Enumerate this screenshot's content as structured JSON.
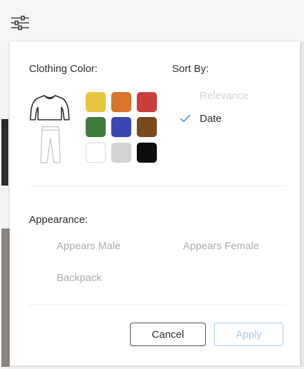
{
  "toolbar": {
    "filter_icon": "sliders-icon"
  },
  "panel": {
    "clothing_color_label": "Clothing Color:",
    "sort_by_label": "Sort By:",
    "appearance_label": "Appearance:",
    "garments": [
      "shirt-icon",
      "pants-icon"
    ],
    "swatches": [
      {
        "name": "yellow",
        "color": "#e8c53f"
      },
      {
        "name": "orange",
        "color": "#d9742b"
      },
      {
        "name": "red",
        "color": "#c83e3a"
      },
      {
        "name": "green",
        "color": "#3f7d3c"
      },
      {
        "name": "blue",
        "color": "#3948b0"
      },
      {
        "name": "brown",
        "color": "#7a4a1e"
      },
      {
        "name": "white",
        "color": "#ffffff"
      },
      {
        "name": "gray",
        "color": "#d3d3d3"
      },
      {
        "name": "black",
        "color": "#0d0d0d"
      }
    ],
    "sort_options": [
      {
        "label": "Relevance",
        "selected": false
      },
      {
        "label": "Date",
        "selected": true
      }
    ],
    "appearance_options": [
      "Appears Male",
      "Appears Female",
      "Backpack"
    ],
    "cancel_label": "Cancel",
    "apply_label": "Apply",
    "accent_color": "#5b9bd5"
  }
}
